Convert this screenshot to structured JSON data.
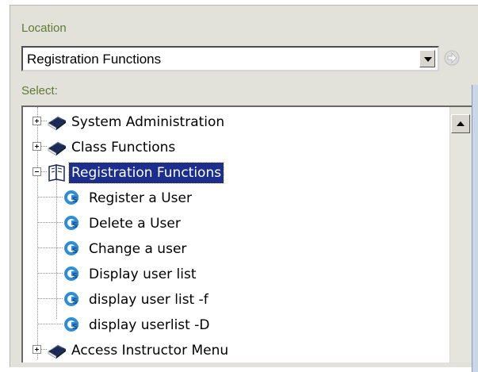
{
  "location": {
    "label": "Location",
    "selected_value": "Registration Functions"
  },
  "select": {
    "label": "Select:"
  },
  "tree": {
    "items": [
      {
        "label": "System Administration",
        "icon": "book-icon",
        "level": 0,
        "expander": "plus",
        "selected": false
      },
      {
        "label": "Class Functions",
        "icon": "book-icon",
        "level": 0,
        "expander": "plus",
        "selected": false
      },
      {
        "label": "Registration Functions",
        "icon": "open-book-icon",
        "level": 0,
        "expander": "minus",
        "selected": true
      },
      {
        "label": "Register a User",
        "icon": "command-icon",
        "level": 1,
        "expander": "none",
        "selected": false
      },
      {
        "label": "Delete a User",
        "icon": "command-icon",
        "level": 1,
        "expander": "none",
        "selected": false
      },
      {
        "label": "Change a user",
        "icon": "command-icon",
        "level": 1,
        "expander": "none",
        "selected": false
      },
      {
        "label": "Display user list",
        "icon": "command-icon",
        "level": 1,
        "expander": "none",
        "selected": false
      },
      {
        "label": "display user list -f",
        "icon": "command-icon",
        "level": 1,
        "expander": "none",
        "selected": false
      },
      {
        "label": "display userlist -D",
        "icon": "command-icon",
        "level": 1,
        "expander": "none",
        "selected": false
      },
      {
        "label": "Access Instructor Menu",
        "icon": "book-icon",
        "level": 0,
        "expander": "plus",
        "selected": false
      }
    ]
  },
  "colors": {
    "label_green": "#5e7a34",
    "selection": "#1c2f8e",
    "panel": "#e2e1da"
  }
}
